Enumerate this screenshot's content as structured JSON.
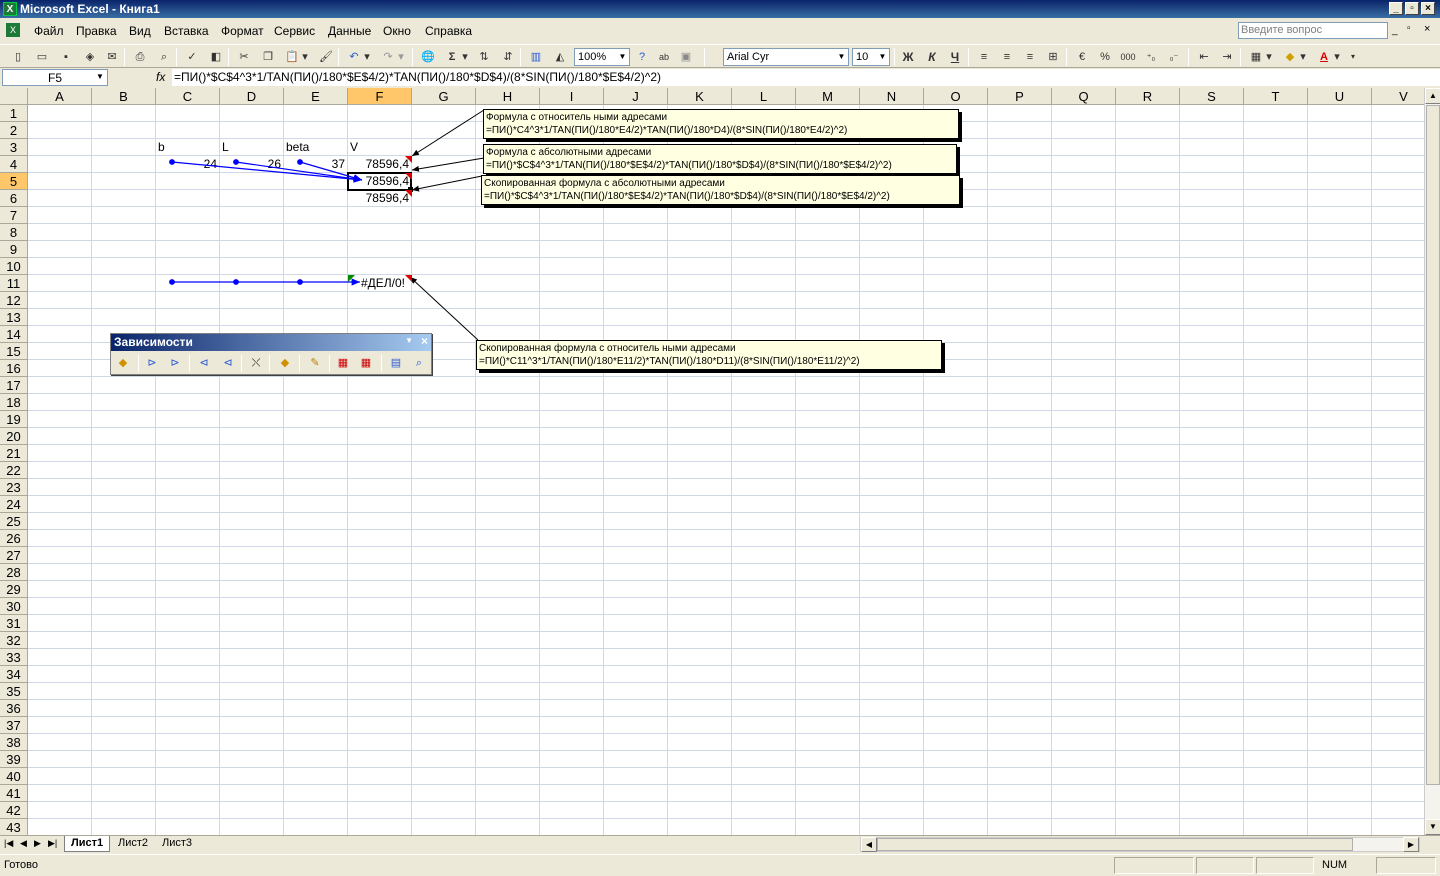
{
  "window": {
    "title": "Microsoft Excel - Книга1",
    "app_icon": "X"
  },
  "menu": {
    "items": [
      "Файл",
      "Правка",
      "Вид",
      "Вставка",
      "Формат",
      "Сервис",
      "Данные",
      "Окно",
      "Справка"
    ],
    "ask_placeholder": "Введите вопрос"
  },
  "toolbar": {
    "zoom": "100%",
    "font": "Arial Cyr",
    "size": "10",
    "bold": "Ж",
    "italic": "К",
    "underline": "Ч",
    "percent": "%",
    "thousands": "000",
    "sum": "Σ",
    "help": "?"
  },
  "formula_bar": {
    "name_box": "F5",
    "fx": "fx",
    "formula": "=ПИ()*$C$4^3*1/TAN(ПИ()/180*$E$4/2)*TAN(ПИ()/180*$D$4)/(8*SIN(ПИ()/180*$E$4/2)^2)"
  },
  "columns": [
    "A",
    "B",
    "C",
    "D",
    "E",
    "F",
    "G",
    "H",
    "I",
    "J",
    "K",
    "L",
    "M",
    "N",
    "O",
    "P",
    "Q",
    "R",
    "S",
    "T",
    "U",
    "V"
  ],
  "selected_column": "F",
  "rows": [
    "1",
    "2",
    "3",
    "4",
    "5",
    "6",
    "7",
    "8",
    "9",
    "10",
    "11",
    "12",
    "13",
    "14",
    "15",
    "16",
    "17",
    "18",
    "19",
    "20",
    "21",
    "22",
    "23",
    "24",
    "25",
    "26",
    "27",
    "28",
    "29",
    "30",
    "31",
    "32",
    "33",
    "34",
    "35",
    "36",
    "37",
    "38",
    "39",
    "40",
    "41",
    "42",
    "43"
  ],
  "selected_row": "5",
  "cells": {
    "C3": "b",
    "D3": "L",
    "E3": "beta",
    "F3": "V",
    "C4": "24",
    "D4": "26",
    "E4": "37",
    "F4": "78596,4",
    "F5": "78596,4",
    "F6": "78596,4",
    "F11": "#ДЕЛ/0!"
  },
  "notes": [
    {
      "line1": "Формула с относитель ными адресами",
      "line2": "=ПИ()*C4^3*1/TAN(ПИ()/180*E4/2)*TAN(ПИ()/180*D4)/(8*SIN(ПИ()/180*E4/2)^2)"
    },
    {
      "line1": "Формула с абсолютными адресами",
      "line2": "=ПИ()*$C$4^3*1/TAN(ПИ()/180*$E$4/2)*TAN(ПИ()/180*$D$4)/(8*SIN(ПИ()/180*$E$4/2)^2)"
    },
    {
      "line1": "Скопированная формула с абсолютными адресами",
      "line2": "=ПИ()*$C$4^3*1/TAN(ПИ()/180*$E$4/2)*TAN(ПИ()/180*$D$4)/(8*SIN(ПИ()/180*$E$4/2)^2)"
    },
    {
      "line1": "Скопированная формула с относитель ными адресами",
      "line2": "=ПИ()*C11^3*1/TAN(ПИ()/180*E11/2)*TAN(ПИ()/180*D11)/(8*SIN(ПИ()/180*E11/2)^2)"
    }
  ],
  "dependencies_toolbar": {
    "title": "Зависимости"
  },
  "sheets": {
    "tabs": [
      "Лист1",
      "Лист2",
      "Лист3"
    ],
    "active": "Лист1"
  },
  "status": {
    "left": "Готово",
    "num": "NUM"
  },
  "colors": {
    "trace_arrow": "#0000ff",
    "error_arrow": "#000000",
    "selection_header": "#ffc76a"
  }
}
